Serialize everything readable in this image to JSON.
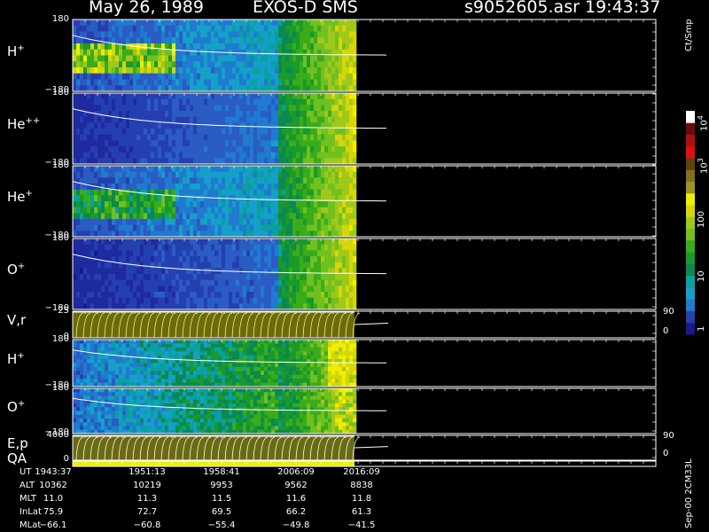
{
  "header": {
    "date": "May 26, 1989",
    "instrument": "EXOS-D SMS",
    "file": "s9052605.asr",
    "time": "19:43:37"
  },
  "colorbar": {
    "unit": "Ct/Smp",
    "ticks": [
      "1",
      "10",
      "100",
      "10",
      "10"
    ],
    "exponents": [
      "",
      "",
      "",
      "3",
      "4"
    ]
  },
  "version_label": "Sep-00 2CM33L",
  "panels": [
    {
      "id": "h1",
      "species": "H",
      "charge": "+",
      "ticks": [
        "180",
        "−180"
      ]
    },
    {
      "id": "he2",
      "species": "He",
      "charge": "++",
      "ticks": [
        "180",
        "−180"
      ]
    },
    {
      "id": "he1",
      "species": "He",
      "charge": "+",
      "ticks": [
        "180",
        "−180"
      ]
    },
    {
      "id": "o1",
      "species": "O",
      "charge": "+",
      "ticks": [
        "180",
        "−180"
      ]
    },
    {
      "id": "vr",
      "species": "V,r",
      "charge": "",
      "ticks": [
        "25",
        "0"
      ],
      "right_ticks": [
        "90",
        "0"
      ]
    },
    {
      "id": "h2",
      "species": "H",
      "charge": "+",
      "ticks": [
        "180",
        "−180"
      ]
    },
    {
      "id": "o2",
      "species": "O",
      "charge": "+",
      "ticks": [
        "180",
        "−180"
      ]
    },
    {
      "id": "ep",
      "species": "E,p",
      "charge": "",
      "ticks": [
        "4000",
        "0"
      ],
      "right_ticks": [
        "90",
        "0"
      ]
    },
    {
      "id": "qa",
      "species": "QA",
      "charge": "",
      "ticks": []
    }
  ],
  "ephemeris": {
    "labels": [
      "UT",
      "ALT",
      "MLT",
      "InLat",
      "MLat"
    ],
    "columns": [
      [
        "1943:37",
        "10362",
        "11.0",
        "75.9",
        "−66.1"
      ],
      [
        "1951:13",
        "10219",
        "11.3",
        "72.7",
        "−60.8"
      ],
      [
        "1958:41",
        "9953",
        "11.5",
        "69.5",
        "−55.4"
      ],
      [
        "2006:09",
        "9562",
        "11.6",
        "66.2",
        "−49.8"
      ],
      [
        "2016:09",
        "8838",
        "11.8",
        "61.3",
        "−41.5"
      ]
    ]
  },
  "chart_data": {
    "type": "heatmap",
    "x_axis": "UT",
    "x_ticks": [
      "1943:37",
      "1951:13",
      "1958:41",
      "2006:09",
      "2016:09"
    ],
    "data_coverage_fraction": 0.5,
    "colorbar": {
      "unit": "Ct/Smp",
      "range": [
        1,
        10000
      ],
      "scale": "log"
    },
    "series": [
      {
        "name": "H+",
        "ylim": [
          -180,
          180
        ]
      },
      {
        "name": "He++",
        "ylim": [
          -180,
          180
        ]
      },
      {
        "name": "He+",
        "ylim": [
          -180,
          180
        ]
      },
      {
        "name": "O+",
        "ylim": [
          -180,
          180
        ]
      },
      {
        "name": "V,r",
        "ylim": [
          0,
          25
        ],
        "right_ylim": [
          0,
          90
        ]
      },
      {
        "name": "H+",
        "ylim": [
          -180,
          180
        ]
      },
      {
        "name": "O+",
        "ylim": [
          -180,
          180
        ]
      },
      {
        "name": "E,p",
        "ylim": [
          0,
          4000
        ],
        "right_ylim": [
          0,
          90
        ]
      },
      {
        "name": "QA"
      }
    ]
  }
}
